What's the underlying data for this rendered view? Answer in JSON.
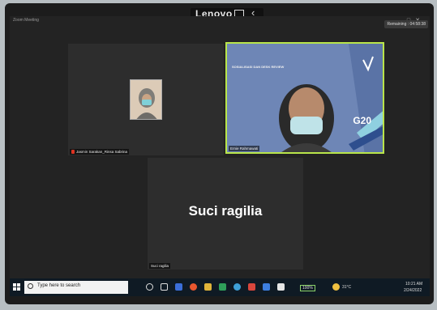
{
  "device": {
    "brand": "Lenovo"
  },
  "window": {
    "title": "Zoom Meeting",
    "remaining": "Remaining : 04:58:38"
  },
  "participants": [
    {
      "name": "Jasmin Sarakan_Rinsa Sabrina"
    },
    {
      "name": "Ernie Rahmawati"
    },
    {
      "name": "Suci ragilia"
    }
  ],
  "shared_slide": {
    "title": "SOSIALISASI DAN DESK REVIEW",
    "logo_text": "G20"
  },
  "taskbar": {
    "search_placeholder": "Type here to search",
    "battery": "100%",
    "weather": "31°C",
    "time": "10:21 AM",
    "date": "2/24/2022"
  },
  "colors": {
    "active_speaker_border": "#b9e54a",
    "taskbar": "#0f1a24"
  }
}
